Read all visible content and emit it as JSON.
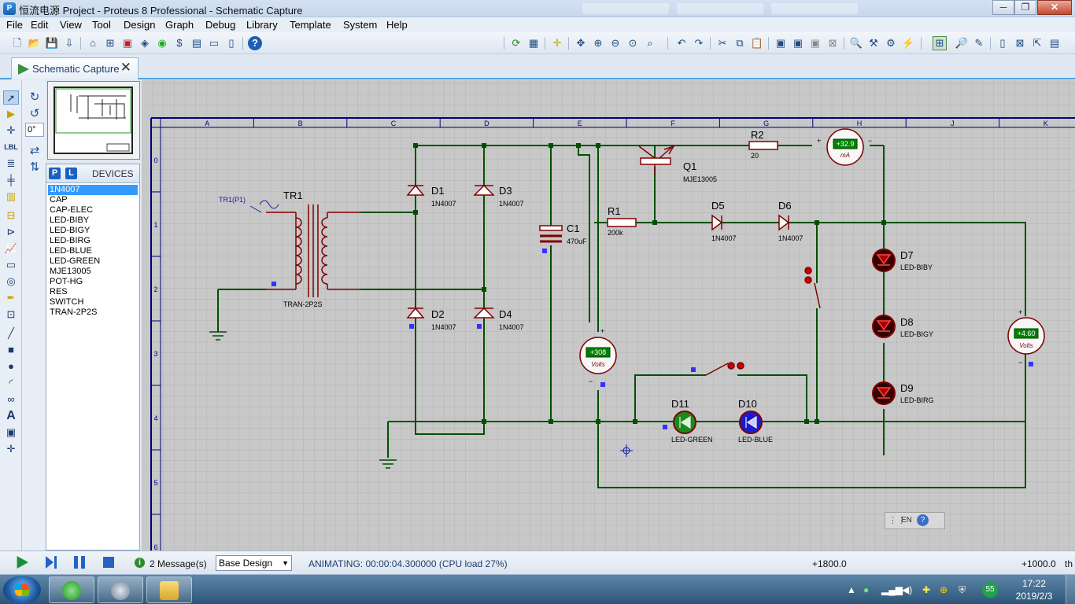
{
  "window": {
    "title": "恒流电源 Project - Proteus 8 Professional - Schematic Capture",
    "controls": [
      "─",
      "❐",
      "✕"
    ]
  },
  "menu": [
    "File",
    "Edit",
    "View",
    "Tool",
    "Design",
    "Graph",
    "Debug",
    "Library",
    "Template",
    "System",
    "Help"
  ],
  "tab": {
    "label": "Schematic Capture",
    "close": "✕"
  },
  "rotation": {
    "value": "0°"
  },
  "devices": {
    "p_label": "P",
    "l_label": "L",
    "title": "DEVICES",
    "selected": 0,
    "items": [
      "1N4007",
      "CAP",
      "CAP-ELEC",
      "LED-BIBY",
      "LED-BIGY",
      "LED-BIRG",
      "LED-BLUE",
      "LED-GREEN",
      "MJE13005",
      "POT-HG",
      "RES",
      "SWITCH",
      "TRAN-2P2S"
    ]
  },
  "schematic": {
    "columns": [
      "A",
      "B",
      "C",
      "D",
      "E",
      "F",
      "G",
      "H",
      "J",
      "K"
    ],
    "rows": [
      "0",
      "1",
      "2",
      "3",
      "4",
      "5",
      "6"
    ],
    "components": {
      "tr1": {
        "ref": "TR1",
        "value": "TRAN-2P2S",
        "probe": "TR1(P1)"
      },
      "d1": {
        "ref": "D1",
        "value": "1N4007"
      },
      "d2": {
        "ref": "D2",
        "value": "1N4007"
      },
      "d3": {
        "ref": "D3",
        "value": "1N4007"
      },
      "d4": {
        "ref": "D4",
        "value": "1N4007"
      },
      "d5": {
        "ref": "D5",
        "value": "1N4007"
      },
      "d6": {
        "ref": "D6",
        "value": "1N4007"
      },
      "c1": {
        "ref": "C1",
        "value": "470uF"
      },
      "r1": {
        "ref": "R1",
        "value": "200k"
      },
      "r2": {
        "ref": "R2",
        "value": "20"
      },
      "q1": {
        "ref": "Q1",
        "value": "MJE13005"
      },
      "d7": {
        "ref": "D7",
        "value": "LED-BIBY"
      },
      "d8": {
        "ref": "D8",
        "value": "LED-BIGY"
      },
      "d9": {
        "ref": "D9",
        "value": "LED-BIRG"
      },
      "d10": {
        "ref": "D10",
        "value": "LED-BLUE"
      },
      "d11": {
        "ref": "D11",
        "value": "LED-GREEN"
      }
    },
    "meters": {
      "ammeter": {
        "reading": "+32.9",
        "unit": "mA",
        "plus": "+",
        "minus": "−"
      },
      "volt1": {
        "reading": "+308",
        "unit": "Volts",
        "plus": "+",
        "minus": "−"
      },
      "volt2": {
        "reading": "+4.60",
        "unit": "Volts",
        "plus": "+",
        "minus": "−"
      }
    },
    "lang_indicator": "EN"
  },
  "status": {
    "messages": "2 Message(s)",
    "design": "Base Design",
    "animating": "ANIMATING: 00:00:04.300000 (CPU load 27%)",
    "coord_x": "+1800.0",
    "coord_y": "+1000.0",
    "unit": "th"
  },
  "taskbar": {
    "time": "17:22",
    "date": "2019/2/3",
    "badge": "55"
  },
  "colors": {
    "wire": "#005000",
    "component": "#800000",
    "grid_bg": "#c8c8c8",
    "grid_line": "#b0b0b0",
    "frame": "#000080",
    "meter_display": "#008000"
  }
}
